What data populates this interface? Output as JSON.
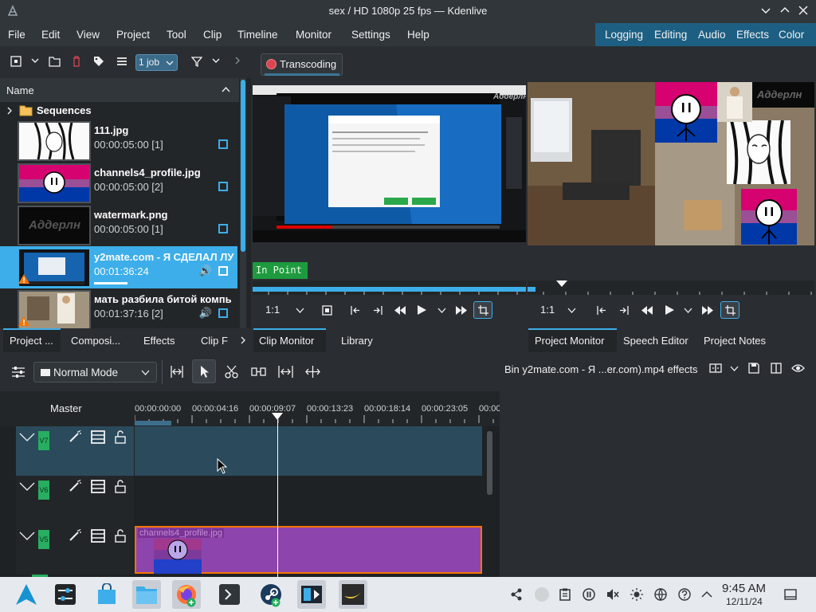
{
  "window": {
    "title": "sex / HD 1080p 25 fps — Kdenlive"
  },
  "menubar": {
    "items": [
      "File",
      "Edit",
      "View",
      "Project",
      "Tool",
      "Clip",
      "Timeline",
      "Monitor",
      "Settings",
      "Help"
    ],
    "layouts": [
      "Logging",
      "Editing",
      "Audio",
      "Effects",
      "Color"
    ]
  },
  "bin_toolbar": {
    "jobs": "1 job"
  },
  "bin": {
    "header": "Name",
    "folder": "Sequences",
    "clips": [
      {
        "name": "111.jpg",
        "duration": "00:00:05:00 [1]"
      },
      {
        "name": "channels4_profile.jpg",
        "duration": "00:00:05:00 [2]"
      },
      {
        "name": "watermark.png",
        "duration": "00:00:05:00 [1]"
      },
      {
        "name": "y2mate.com - Я СДЕЛАЛ ЛУ",
        "duration": "00:01:36:24"
      },
      {
        "name": "мать разбила битой компь",
        "duration": "00:01:37:16 [2]"
      }
    ],
    "watermark_text": "Аддерлн"
  },
  "left_tabs": [
    "Project ...",
    "Composi...",
    "Effects",
    "Clip F"
  ],
  "monitor": {
    "transcoding": "Transcoding",
    "in_point": "In Point",
    "clip_zoom": "1:1",
    "project_zoom": "1:1",
    "watermark_text": "Аддерлн"
  },
  "mid_tabs": [
    "Clip Monitor",
    "Library"
  ],
  "right_tabs": [
    "Project Monitor",
    "Speech Editor",
    "Project Notes"
  ],
  "timeline_toolbar": {
    "mode": "Normal Mode"
  },
  "timeline": {
    "master": "Master",
    "timecodes": [
      "00:00:00:00",
      "00:00:04:16",
      "00:00:09:07",
      "00:00:13:23",
      "00:00:18:14",
      "00:00:23:05",
      "00:00"
    ],
    "tracks": [
      "V7",
      "V6",
      "V5"
    ],
    "clip_label": "channels4_profile.jpg"
  },
  "effects_panel": {
    "title": "Bin y2mate.com - Я ...er.com).mp4 effects"
  },
  "taskbar": {
    "time": "9:45 AM",
    "date": "12/11/24"
  },
  "colors": {
    "accent": "#3daee9",
    "selection": "#1d5f83",
    "track_tag": "#27ae60",
    "clip_purple": "#8e44ad",
    "clip_border": "#f67400"
  }
}
